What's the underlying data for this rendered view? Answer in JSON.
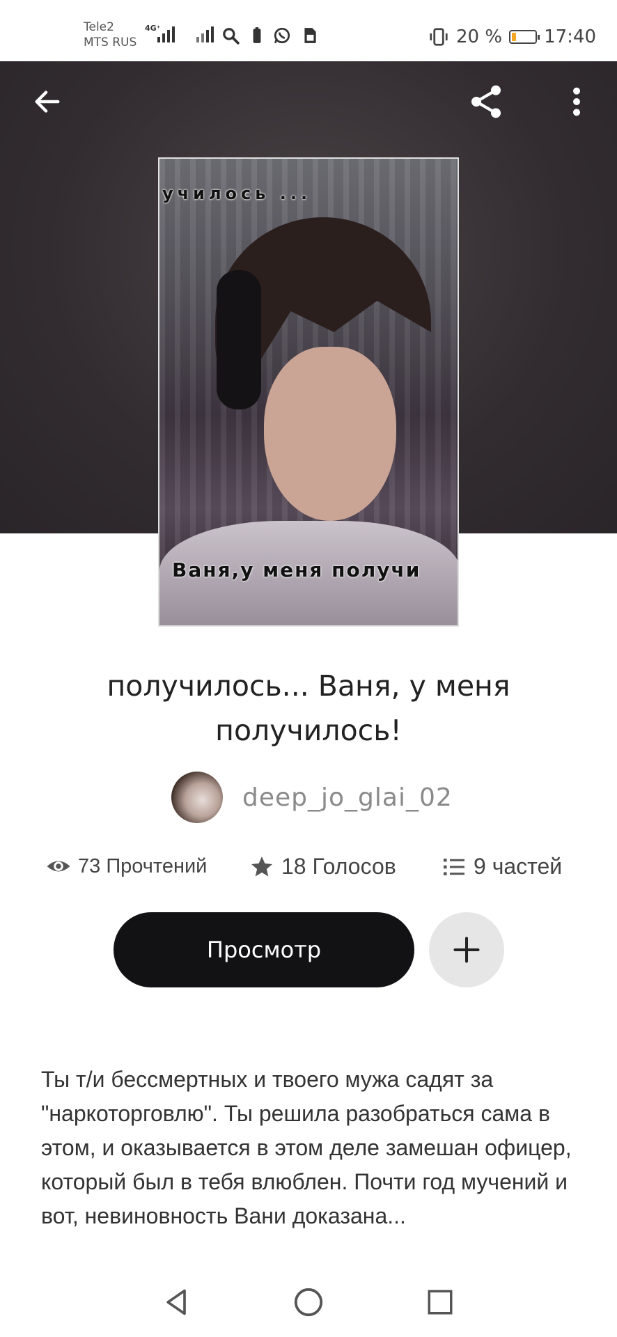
{
  "status_bar": {
    "carrier_1": "Tele2",
    "carrier_2": "MTS RUS",
    "network_label": "4G⁺",
    "battery_level": "20 %",
    "battery_fraction": 0.2,
    "time": "17:40"
  },
  "header": {
    "back_icon": "arrow-left-icon",
    "share_icon": "share-icon",
    "more_icon": "more-vertical-icon"
  },
  "cover": {
    "top_text": "училось ...",
    "bottom_text": "Ваня,у меня получи"
  },
  "story": {
    "title": "получилось... Ваня, у меня получилось!",
    "author": "deep_jo_glai_02",
    "reads": "73 Прочтений",
    "votes": "18 Голосов",
    "parts": "9 частей",
    "description": "Ты т/и бессмертных и твоего мужа садят за \"наркоторговлю\". Ты решила разобраться сама в этом, и оказывается в этом деле замешан офицер, который был в тебя влюблен. Почти год мучений  и вот,  невиновность Вани доказана..."
  },
  "actions": {
    "read_label": "Просмотр",
    "add_icon": "plus-icon"
  },
  "colors": {
    "banner": "#322c30",
    "primary_button": "#121113",
    "secondary_button": "#e6e6e6",
    "battery_fill": "#f5a623"
  }
}
